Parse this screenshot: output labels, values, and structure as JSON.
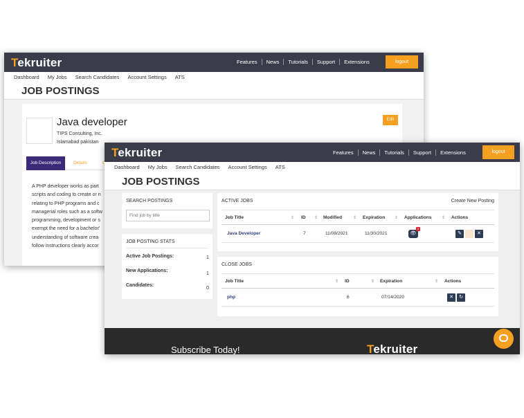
{
  "back": {
    "logo_t": "T",
    "logo_rest": "ekruiter",
    "nav": [
      "Features",
      "News",
      "Tutorials",
      "Support",
      "Extensions"
    ],
    "logout": "logout",
    "subnav": [
      "Dashboard",
      "My Jobs",
      "Search Candidates",
      "Account Settings",
      "ATS"
    ],
    "page_title": "JOB POSTINGS",
    "job_title": "Java developer",
    "company": "TIPS Consulting, Inc.",
    "location": "Islamabad pakistan",
    "edit": "Edit",
    "tabs": [
      "Job Description",
      "Details",
      "C"
    ],
    "description_lines": [
      "A PHP developer works as part",
      "scripts and coding to create or n",
      "relating to PHP programs and c",
      "managerial roles such as a softw",
      "programming, development or s",
      "exempt the need for a bachelor'",
      "understanding of software crea",
      "follow instructions clearly accor"
    ]
  },
  "front": {
    "logo_t": "T",
    "logo_rest": "ekruiter",
    "nav": [
      "Features",
      "News",
      "Tutorials",
      "Support",
      "Extensions"
    ],
    "logout": "logout",
    "subnav": [
      "Dashboard",
      "My Jobs",
      "Search Candidates",
      "Account Settings",
      "ATS"
    ],
    "page_title": "JOB POSTINGS",
    "search": {
      "title": "SEARCH POSTINGS",
      "placeholder": "Find job by title"
    },
    "stats": {
      "title": "JOB POSTING STATS",
      "items": [
        {
          "label": "Active Job Postings:",
          "value": "1"
        },
        {
          "label": "New Applications:",
          "value": "1"
        },
        {
          "label": "Candidates:",
          "value": "0"
        }
      ]
    },
    "active_jobs": {
      "title": "ACTIVE JOBS",
      "create": "Create New Posting",
      "headers": [
        "Job Title",
        "ID",
        "Modified",
        "Expiration",
        "Applications",
        "Actions"
      ],
      "rows": [
        {
          "title": "Java Developer",
          "id": "7",
          "modified": "11/08/2021",
          "expiration": "11/30/2021",
          "badge": "1"
        }
      ]
    },
    "close_jobs": {
      "title": "CLOSE JOBS",
      "headers": [
        "Job Title",
        "ID",
        "Expiration",
        "Actions"
      ],
      "rows": [
        {
          "title": "php",
          "id": "6",
          "expiration": "07/14/2020"
        }
      ]
    },
    "footer": {
      "subscribe": "Subscribe Today!",
      "logo_t": "T",
      "logo_rest": "ekruiter"
    }
  },
  "colors": {
    "accent": "#f5a021",
    "topbar": "#3a3d49",
    "action_button": "#2e3b55",
    "tab_active": "#3b2a7a",
    "footer": "#2a2a2a"
  }
}
